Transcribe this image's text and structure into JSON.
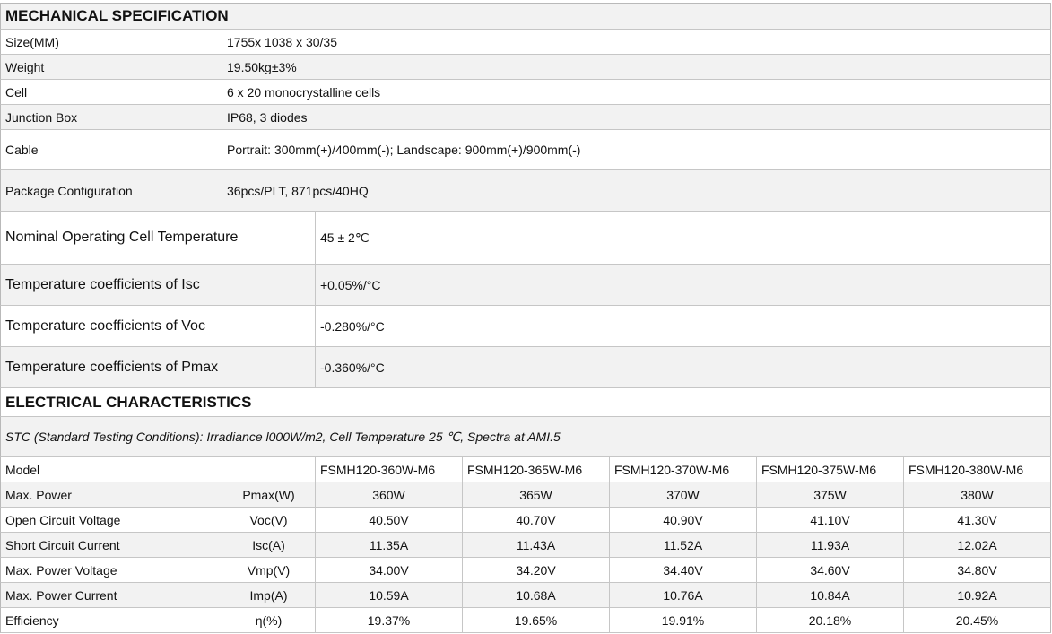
{
  "mechanical": {
    "title": "MECHANICAL SPECIFICATION",
    "rows": [
      {
        "label": "Size(MM)",
        "value": "1755x 1038 x 30/35"
      },
      {
        "label": "Weight",
        "value": "19.50kg±3%"
      },
      {
        "label": "Cell",
        "value": "6 x 20 monocrystalline cells"
      },
      {
        "label": "Junction Box",
        "value": "IP68, 3 diodes"
      },
      {
        "label": "Cable",
        "value": "Portrait: 300mm(+)/400mm(-); Landscape: 900mm(+)/900mm(-)"
      },
      {
        "label": "Package Configuration",
        "value": "36pcs/PLT, 871pcs/40HQ"
      }
    ]
  },
  "temperature": {
    "rows": [
      {
        "label": "Nominal Operating Cell Temperature",
        "value": "45 ± 2℃"
      },
      {
        "label": "Temperature coefficients of Isc",
        "value": "+0.05%/°C"
      },
      {
        "label": "Temperature coefficients of Voc",
        "value": "-0.280%/°C"
      },
      {
        "label": "Temperature coefficients of Pmax",
        "value": "-0.360%/°C"
      }
    ]
  },
  "electrical": {
    "title": "ELECTRICAL CHARACTERISTICS",
    "stc_note": "STC (Standard Testing Conditions): Irradiance l000W/m2, Cell Temperature 25  ℃, Spectra at AMI.5",
    "model_label": "Model",
    "models": [
      "FSMH120-360W-M6",
      "FSMH120-365W-M6",
      "FSMH120-370W-M6",
      "FSMH120-375W-M6",
      "FSMH120-380W-M6"
    ],
    "rows": [
      {
        "label": "Max. Power",
        "symbol": "Pmax(W)",
        "values": [
          "360W",
          "365W",
          "370W",
          "375W",
          "380W"
        ]
      },
      {
        "label": "Open Circuit Voltage",
        "symbol": "Voc(V)",
        "values": [
          "40.50V",
          "40.70V",
          "40.90V",
          "41.10V",
          "41.30V"
        ]
      },
      {
        "label": "Short Circuit Current",
        "symbol": "Isc(A)",
        "values": [
          "11.35A",
          "11.43A",
          "11.52A",
          "11.93A",
          "12.02A"
        ]
      },
      {
        "label": "Max. Power Voltage",
        "symbol": "Vmp(V)",
        "values": [
          "34.00V",
          "34.20V",
          "34.40V",
          "34.60V",
          "34.80V"
        ]
      },
      {
        "label": "Max. Power Current",
        "symbol": "Imp(A)",
        "values": [
          "10.59A",
          "10.68A",
          "10.76A",
          "10.84A",
          "10.92A"
        ]
      },
      {
        "label": "Efficiency",
        "symbol": "η(%)",
        "values": [
          "19.37%",
          "19.65%",
          "19.91%",
          "20.18%",
          "20.45%"
        ]
      }
    ]
  }
}
